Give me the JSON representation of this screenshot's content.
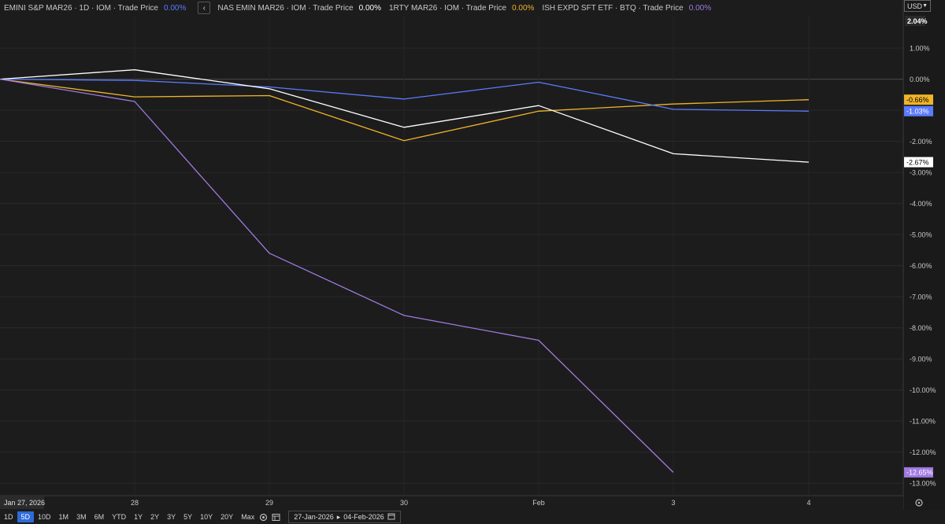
{
  "legend": [
    {
      "label": "EMINI S&P MAR26 · 1D · IOM · Trade Price",
      "value": "0.00%",
      "color": "#5b7bff"
    },
    {
      "label": "NAS EMIN MAR26 · IOM · Trade Price",
      "value": "0.00%",
      "color": "#ffffff"
    },
    {
      "label": "1RTY MAR26 · IOM · Trade Price",
      "value": "0.00%",
      "color": "#f0b429"
    },
    {
      "label": "ISH EXPD SFT ETF · BTQ · Trade Price",
      "value": "0.00%",
      "color": "#a07ae0"
    }
  ],
  "collapse_icon": "chevron-left-icon",
  "currency": "USD",
  "chart_data": {
    "type": "line",
    "x_labels": [
      "Jan 27, 2026",
      "28",
      "29",
      "30",
      "Feb",
      "3",
      "4"
    ],
    "ylim": [
      -13.4,
      2.04
    ],
    "y_ticks": [
      "1.00%",
      "0.00%",
      "-1.00%",
      "-2.00%",
      "-3.00%",
      "-4.00%",
      "-5.00%",
      "-6.00%",
      "-7.00%",
      "-8.00%",
      "-9.00%",
      "-10.00%",
      "-11.00%",
      "-12.00%",
      "-13.00%"
    ],
    "y_tick_values": [
      1,
      0,
      -1,
      -2,
      -3,
      -4,
      -5,
      -6,
      -7,
      -8,
      -9,
      -10,
      -11,
      -12,
      -13
    ],
    "top_label": "2.04%",
    "series": [
      {
        "name": "EMINI S&P MAR26",
        "color": "#5b7bff",
        "values": [
          0,
          -0.04,
          -0.25,
          -0.64,
          -0.1,
          -0.97,
          -1.03
        ],
        "last_label": "-1.03%"
      },
      {
        "name": "NAS EMIN MAR26",
        "color": "#ffffff",
        "values": [
          0,
          0.3,
          -0.31,
          -1.55,
          -0.85,
          -2.4,
          -2.67
        ],
        "last_label": "-2.67%"
      },
      {
        "name": "1RTY MAR26",
        "color": "#f0b429",
        "values": [
          0,
          -0.57,
          -0.53,
          -1.98,
          -1.03,
          -0.8,
          -0.66
        ],
        "last_label": "-0.66%"
      },
      {
        "name": "ISH EXPD SFT ETF",
        "color": "#a07ae0",
        "values": [
          0,
          -0.72,
          -5.6,
          -7.6,
          -8.4,
          -12.65,
          null
        ],
        "last_label": "-12.65%"
      }
    ],
    "grid": true
  },
  "toolbar": {
    "ranges": [
      "1D",
      "5D",
      "10D",
      "1M",
      "3M",
      "6M",
      "YTD",
      "1Y",
      "2Y",
      "3Y",
      "5Y",
      "10Y",
      "20Y",
      "Max"
    ],
    "active_range": "5D",
    "date_from": "27-Jan-2026",
    "date_to": "04-Feb-2026",
    "icons": [
      "settings-icon",
      "table-view-icon",
      "calendar-icon",
      "target-icon"
    ]
  }
}
